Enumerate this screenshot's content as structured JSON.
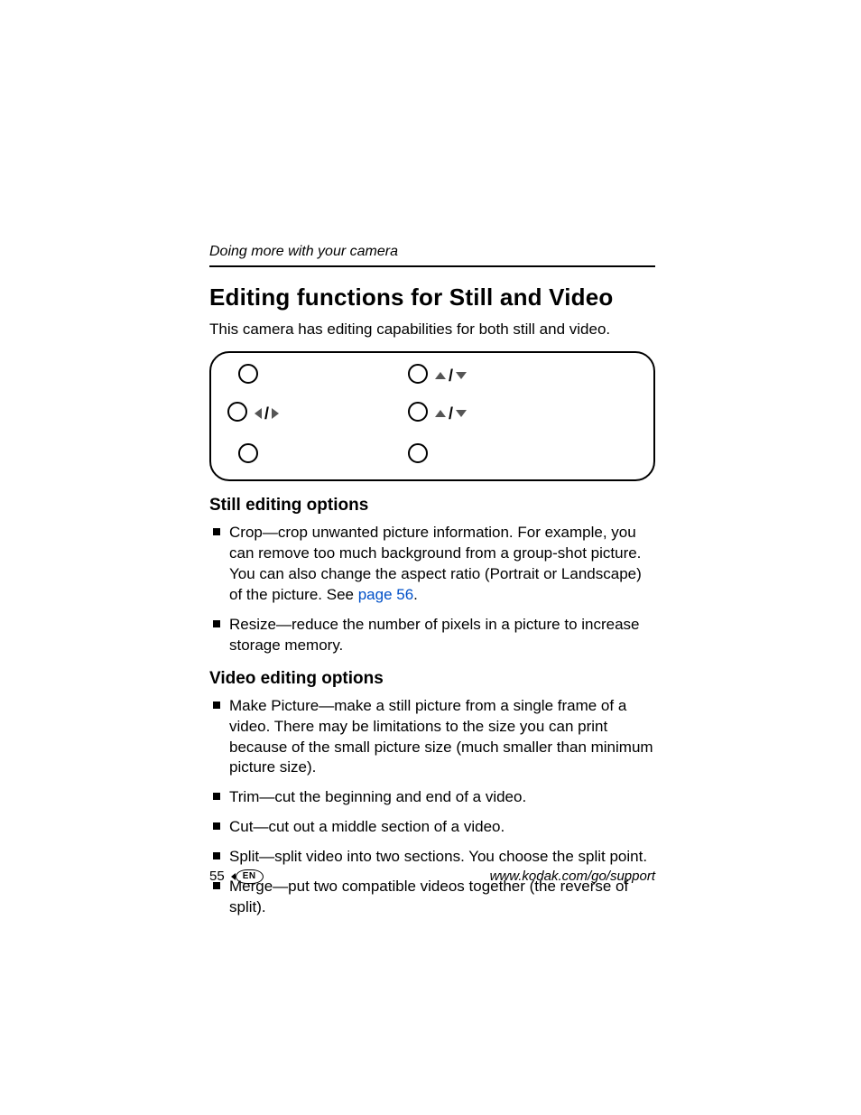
{
  "running_head": "Doing more with your camera",
  "title": "Editing functions for Still and Video",
  "intro": "This camera has editing capabilities for both still and video.",
  "still": {
    "heading": "Still editing options",
    "items": [
      {
        "text_a": "Crop—crop unwanted picture information. For example, you can remove too much background from a group-shot picture. You can also change the aspect ratio (Portrait or Landscape) of the picture. See ",
        "link": "page 56",
        "text_b": "."
      },
      {
        "text_a": "Resize—reduce the number of pixels in a picture to increase storage memory."
      }
    ]
  },
  "video": {
    "heading": "Video editing options",
    "items": [
      {
        "text_a": "Make Picture—make a still picture from a single frame of a video. There may be limitations to the size you can print because of the small picture size (much smaller than minimum picture size)."
      },
      {
        "text_a": "Trim—cut the beginning and end of a video."
      },
      {
        "text_a": "Cut—cut out a middle section of a video."
      },
      {
        "text_a": "Split—split video into two sections. You choose the split point."
      },
      {
        "text_a": "Merge—put two compatible videos together (the reverse of split)."
      }
    ]
  },
  "footer": {
    "page_number": "55",
    "lang": "EN",
    "url": "www.kodak.com/go/support"
  }
}
